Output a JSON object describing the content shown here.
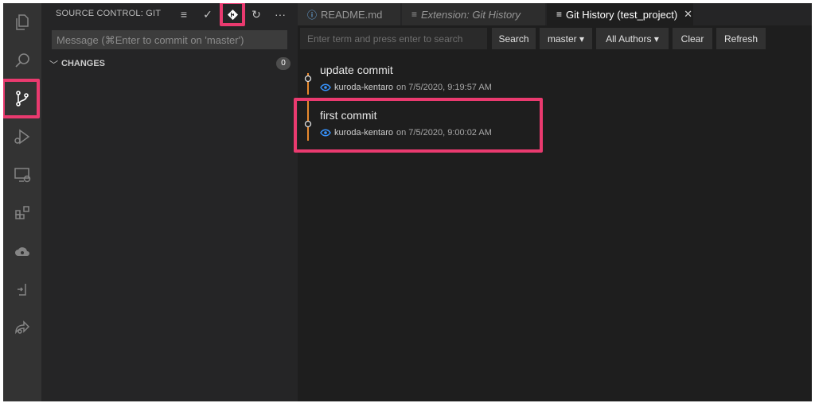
{
  "sidebar": {
    "title": "SOURCE CONTROL: GIT",
    "message_placeholder": "Message (⌘Enter to commit on 'master')",
    "changes_label": "CHANGES",
    "changes_count": "0",
    "actions": {
      "list": "≡",
      "check": "✓",
      "refresh": "↻",
      "more": "···"
    }
  },
  "activity_bar": {
    "items": [
      "explorer-icon",
      "search-icon",
      "source-control-icon",
      "debug-icon",
      "remote-explorer-icon",
      "extensions-icon",
      "cloud-icon",
      "container-icon",
      "live-share-icon"
    ]
  },
  "tabs": [
    {
      "label": "README.md",
      "icon": "ⓘ"
    },
    {
      "label": "Extension: Git History",
      "icon": "≡"
    },
    {
      "label": "Git History (test_project)",
      "icon": "≡",
      "close": "✕"
    }
  ],
  "history_toolbar": {
    "search_placeholder": "Enter term and press enter to search",
    "search_button": "Search",
    "branch": "master ▾",
    "authors": "All Authors ▾",
    "clear": "Clear",
    "refresh": "Refresh"
  },
  "commits": [
    {
      "title": "update commit",
      "author": "kuroda-kentaro",
      "date": "on 7/5/2020, 9:19:57 AM"
    },
    {
      "title": "first commit",
      "author": "kuroda-kentaro",
      "date": "on 7/5/2020, 9:00:02 AM"
    }
  ],
  "colors": {
    "highlight": "#ea3a6f",
    "graph_line": "#e8892e",
    "eye_icon": "#3794ff"
  }
}
